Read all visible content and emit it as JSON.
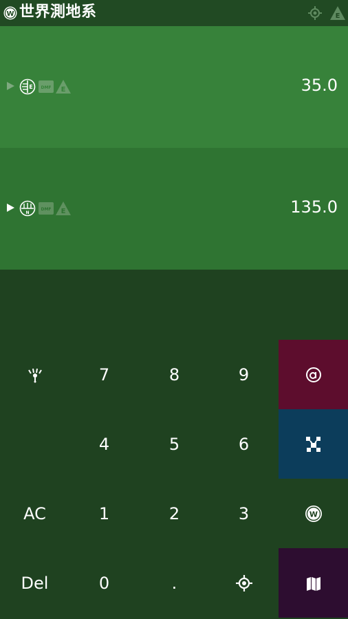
{
  "header": {
    "title": "世界測地系",
    "title_icon": "globe-w-icon",
    "right_icons": [
      "gps-target-icon",
      "e-triangle-icon"
    ]
  },
  "latitude": {
    "value": "35.0",
    "icons": [
      "lat-globe-icon",
      "dmf-badge-icon",
      "e-triangle-icon"
    ],
    "dmf_text": "DMF"
  },
  "longitude": {
    "value": "135.0",
    "icons": [
      "lon-globe-icon",
      "dmf-badge-icon",
      "e-triangle-icon"
    ],
    "dmf_text": "DMF"
  },
  "keypad": {
    "rows": [
      [
        "signal-icon",
        "7",
        "8",
        "9",
        "at-icon"
      ],
      [
        "",
        "4",
        "5",
        "6",
        "chart-icon"
      ],
      [
        "AC",
        "1",
        "2",
        "3",
        "globe-icon"
      ],
      [
        "Del",
        "0",
        ".",
        "locate-icon",
        "map-icon"
      ]
    ],
    "accent_colors": {
      "at": "#5d0d2d",
      "chart": "#0c3d5b",
      "map": "#2d0d30"
    }
  },
  "colors": {
    "title_bar": "#214a23",
    "lat_panel": "#37823a",
    "lon_panel": "#2f7432",
    "keypad_bg": "#1f4220"
  }
}
